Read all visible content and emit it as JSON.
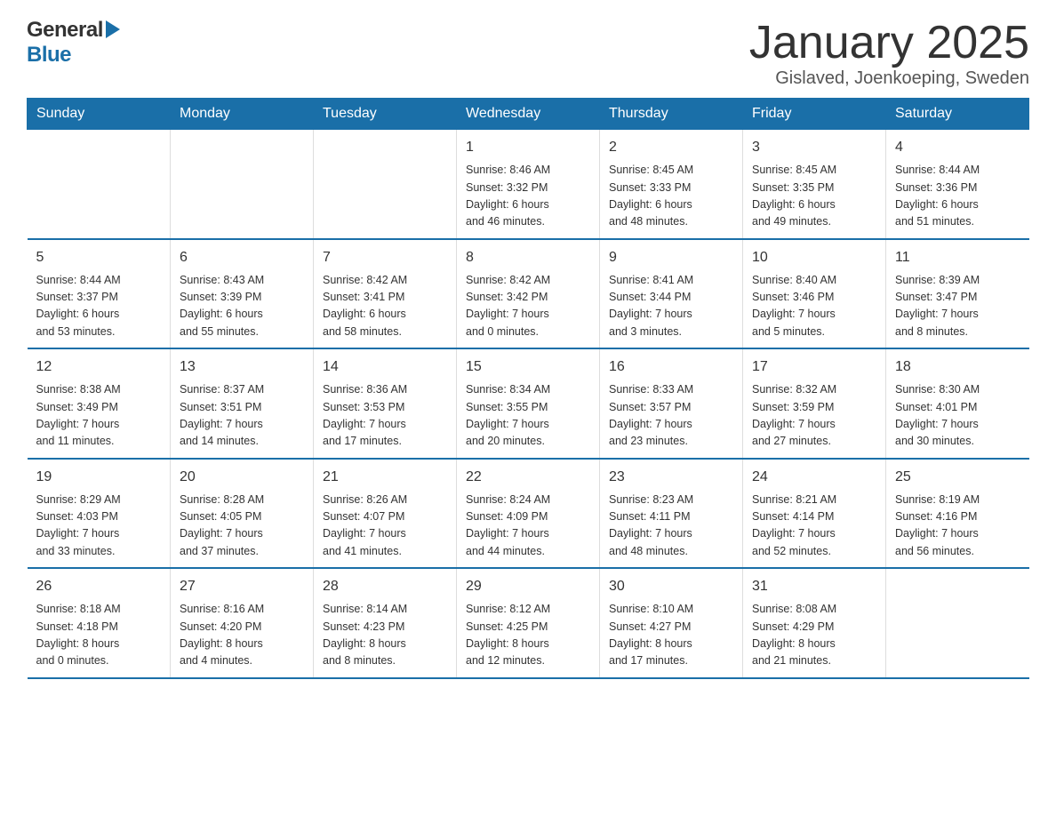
{
  "header": {
    "logo_general": "General",
    "logo_blue": "Blue",
    "title": "January 2025",
    "location": "Gislaved, Joenkoeping, Sweden"
  },
  "calendar": {
    "weekdays": [
      "Sunday",
      "Monday",
      "Tuesday",
      "Wednesday",
      "Thursday",
      "Friday",
      "Saturday"
    ],
    "weeks": [
      [
        {
          "day": "",
          "info": ""
        },
        {
          "day": "",
          "info": ""
        },
        {
          "day": "",
          "info": ""
        },
        {
          "day": "1",
          "info": "Sunrise: 8:46 AM\nSunset: 3:32 PM\nDaylight: 6 hours\nand 46 minutes."
        },
        {
          "day": "2",
          "info": "Sunrise: 8:45 AM\nSunset: 3:33 PM\nDaylight: 6 hours\nand 48 minutes."
        },
        {
          "day": "3",
          "info": "Sunrise: 8:45 AM\nSunset: 3:35 PM\nDaylight: 6 hours\nand 49 minutes."
        },
        {
          "day": "4",
          "info": "Sunrise: 8:44 AM\nSunset: 3:36 PM\nDaylight: 6 hours\nand 51 minutes."
        }
      ],
      [
        {
          "day": "5",
          "info": "Sunrise: 8:44 AM\nSunset: 3:37 PM\nDaylight: 6 hours\nand 53 minutes."
        },
        {
          "day": "6",
          "info": "Sunrise: 8:43 AM\nSunset: 3:39 PM\nDaylight: 6 hours\nand 55 minutes."
        },
        {
          "day": "7",
          "info": "Sunrise: 8:42 AM\nSunset: 3:41 PM\nDaylight: 6 hours\nand 58 minutes."
        },
        {
          "day": "8",
          "info": "Sunrise: 8:42 AM\nSunset: 3:42 PM\nDaylight: 7 hours\nand 0 minutes."
        },
        {
          "day": "9",
          "info": "Sunrise: 8:41 AM\nSunset: 3:44 PM\nDaylight: 7 hours\nand 3 minutes."
        },
        {
          "day": "10",
          "info": "Sunrise: 8:40 AM\nSunset: 3:46 PM\nDaylight: 7 hours\nand 5 minutes."
        },
        {
          "day": "11",
          "info": "Sunrise: 8:39 AM\nSunset: 3:47 PM\nDaylight: 7 hours\nand 8 minutes."
        }
      ],
      [
        {
          "day": "12",
          "info": "Sunrise: 8:38 AM\nSunset: 3:49 PM\nDaylight: 7 hours\nand 11 minutes."
        },
        {
          "day": "13",
          "info": "Sunrise: 8:37 AM\nSunset: 3:51 PM\nDaylight: 7 hours\nand 14 minutes."
        },
        {
          "day": "14",
          "info": "Sunrise: 8:36 AM\nSunset: 3:53 PM\nDaylight: 7 hours\nand 17 minutes."
        },
        {
          "day": "15",
          "info": "Sunrise: 8:34 AM\nSunset: 3:55 PM\nDaylight: 7 hours\nand 20 minutes."
        },
        {
          "day": "16",
          "info": "Sunrise: 8:33 AM\nSunset: 3:57 PM\nDaylight: 7 hours\nand 23 minutes."
        },
        {
          "day": "17",
          "info": "Sunrise: 8:32 AM\nSunset: 3:59 PM\nDaylight: 7 hours\nand 27 minutes."
        },
        {
          "day": "18",
          "info": "Sunrise: 8:30 AM\nSunset: 4:01 PM\nDaylight: 7 hours\nand 30 minutes."
        }
      ],
      [
        {
          "day": "19",
          "info": "Sunrise: 8:29 AM\nSunset: 4:03 PM\nDaylight: 7 hours\nand 33 minutes."
        },
        {
          "day": "20",
          "info": "Sunrise: 8:28 AM\nSunset: 4:05 PM\nDaylight: 7 hours\nand 37 minutes."
        },
        {
          "day": "21",
          "info": "Sunrise: 8:26 AM\nSunset: 4:07 PM\nDaylight: 7 hours\nand 41 minutes."
        },
        {
          "day": "22",
          "info": "Sunrise: 8:24 AM\nSunset: 4:09 PM\nDaylight: 7 hours\nand 44 minutes."
        },
        {
          "day": "23",
          "info": "Sunrise: 8:23 AM\nSunset: 4:11 PM\nDaylight: 7 hours\nand 48 minutes."
        },
        {
          "day": "24",
          "info": "Sunrise: 8:21 AM\nSunset: 4:14 PM\nDaylight: 7 hours\nand 52 minutes."
        },
        {
          "day": "25",
          "info": "Sunrise: 8:19 AM\nSunset: 4:16 PM\nDaylight: 7 hours\nand 56 minutes."
        }
      ],
      [
        {
          "day": "26",
          "info": "Sunrise: 8:18 AM\nSunset: 4:18 PM\nDaylight: 8 hours\nand 0 minutes."
        },
        {
          "day": "27",
          "info": "Sunrise: 8:16 AM\nSunset: 4:20 PM\nDaylight: 8 hours\nand 4 minutes."
        },
        {
          "day": "28",
          "info": "Sunrise: 8:14 AM\nSunset: 4:23 PM\nDaylight: 8 hours\nand 8 minutes."
        },
        {
          "day": "29",
          "info": "Sunrise: 8:12 AM\nSunset: 4:25 PM\nDaylight: 8 hours\nand 12 minutes."
        },
        {
          "day": "30",
          "info": "Sunrise: 8:10 AM\nSunset: 4:27 PM\nDaylight: 8 hours\nand 17 minutes."
        },
        {
          "day": "31",
          "info": "Sunrise: 8:08 AM\nSunset: 4:29 PM\nDaylight: 8 hours\nand 21 minutes."
        },
        {
          "day": "",
          "info": ""
        }
      ]
    ]
  }
}
